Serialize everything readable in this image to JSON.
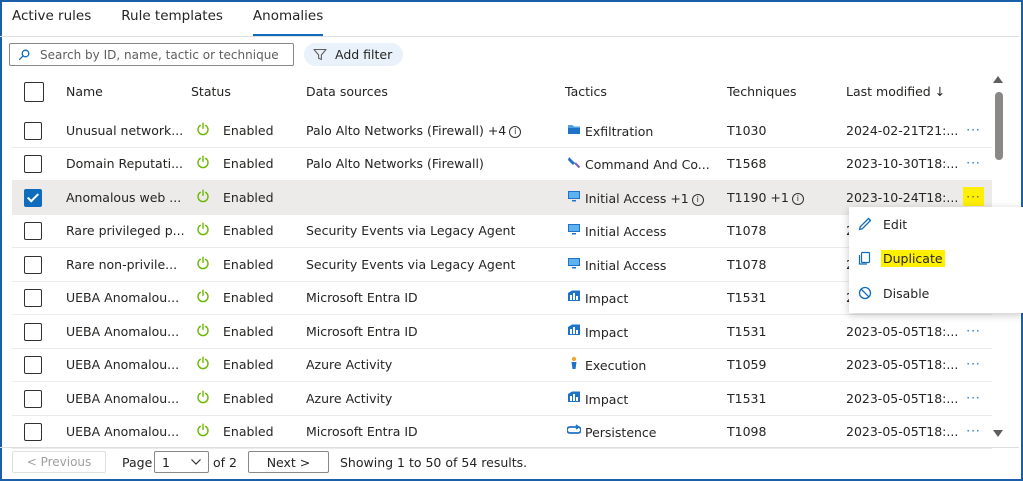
{
  "tabs": [
    "Active rules",
    "Rule templates",
    "Anomalies"
  ],
  "search": {
    "placeholder": "Search by ID, name, tactic or technique",
    "icon": "search-icon"
  },
  "add_filter": "Add filter",
  "columns": {
    "name": "Name",
    "status": "Status",
    "data_sources": "Data sources",
    "tactics": "Tactics",
    "techniques": "Techniques",
    "last_modified": "Last modified ↓"
  },
  "rows": [
    {
      "name": "Unusual network...",
      "status": "Enabled",
      "data_sources": "Palo Alto Networks (Firewall) +4",
      "data_sources_info": "i",
      "tactic_icon": "folder-icon",
      "tactic": "Exfiltration",
      "technique": "T1030",
      "last_modified": "2024-02-21T21:...",
      "selected": false
    },
    {
      "name": "Domain Reputati...",
      "status": "Enabled",
      "data_sources": "Palo Alto Networks (Firewall)",
      "data_sources_info": "",
      "tactic_icon": "command-icon",
      "tactic": "Command And Co...",
      "technique": "T1568",
      "last_modified": "2023-10-30T18:...",
      "selected": false
    },
    {
      "name": "Anomalous web ...",
      "status": "Enabled",
      "data_sources": "",
      "data_sources_info": "",
      "tactic_icon": "monitor-icon",
      "tactic": "Initial Access +1",
      "tactic_info": "i",
      "technique": "T1190 +1",
      "technique_info": "i",
      "last_modified": "2023-10-24T18:...",
      "selected": true
    },
    {
      "name": "Rare privileged p...",
      "status": "Enabled",
      "data_sources": "Security Events via Legacy Agent",
      "data_sources_info": "",
      "tactic_icon": "monitor-icon",
      "tactic": "Initial Access",
      "technique": "T1078",
      "last_modified": "2",
      "selected": false
    },
    {
      "name": "Rare non-privile...",
      "status": "Enabled",
      "data_sources": "Security Events via Legacy Agent",
      "data_sources_info": "",
      "tactic_icon": "monitor-icon",
      "tactic": "Initial Access",
      "technique": "T1078",
      "last_modified": "2",
      "selected": false
    },
    {
      "name": "UEBA Anomalou...",
      "status": "Enabled",
      "data_sources": "Microsoft Entra ID",
      "data_sources_info": "",
      "tactic_icon": "impact-icon",
      "tactic": "Impact",
      "technique": "T1531",
      "last_modified": "2",
      "selected": false
    },
    {
      "name": "UEBA Anomalou...",
      "status": "Enabled",
      "data_sources": "Microsoft Entra ID",
      "data_sources_info": "",
      "tactic_icon": "impact-icon",
      "tactic": "Impact",
      "technique": "T1531",
      "last_modified": "2023-05-05T18:...",
      "selected": false
    },
    {
      "name": "UEBA Anomalou...",
      "status": "Enabled",
      "data_sources": "Azure Activity",
      "data_sources_info": "",
      "tactic_icon": "execution-icon",
      "tactic": "Execution",
      "technique": "T1059",
      "last_modified": "2023-05-05T18:...",
      "selected": false
    },
    {
      "name": "UEBA Anomalou...",
      "status": "Enabled",
      "data_sources": "Azure Activity",
      "data_sources_info": "",
      "tactic_icon": "impact-icon",
      "tactic": "Impact",
      "technique": "T1531",
      "last_modified": "2023-05-05T18:...",
      "selected": false
    },
    {
      "name": "UEBA Anomalou...",
      "status": "Enabled",
      "data_sources": "Microsoft Entra ID",
      "data_sources_info": "",
      "tactic_icon": "persistence-icon",
      "tactic": "Persistence",
      "technique": "T1098",
      "last_modified": "2023-05-05T18:...",
      "selected": false
    }
  ],
  "more_label": "···",
  "context_menu": {
    "edit": "Edit",
    "duplicate": "Duplicate",
    "disable": "Disable"
  },
  "pagination": {
    "previous": "< Previous",
    "page_label": "Page",
    "page_value": "1",
    "of_label": "of 2",
    "next": "Next >",
    "results": "Showing 1 to 50 of 54 results."
  },
  "colors": {
    "accent": "#0f6cbd",
    "status_green": "#6bb700",
    "highlight": "#ffef00",
    "frame_border": "#1a5fa8"
  }
}
